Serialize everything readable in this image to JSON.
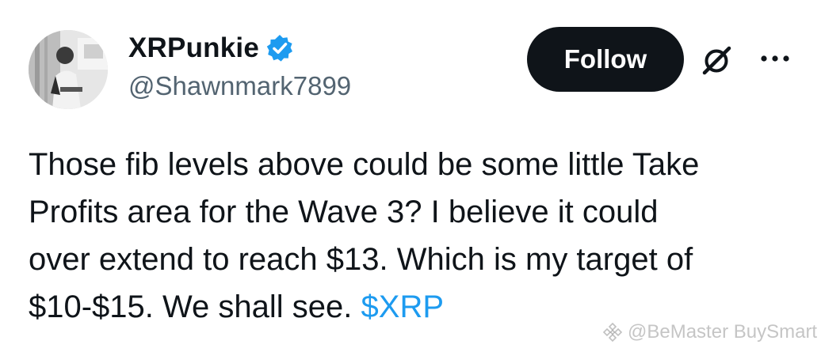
{
  "user": {
    "display_name": "XRPunkie",
    "handle": "@Shawnmark7899",
    "verified": true,
    "avatar_icon": "profile-photo"
  },
  "actions": {
    "follow_label": "Follow",
    "grok_icon": "grok-icon",
    "more_icon": "more-icon"
  },
  "tweet": {
    "lines": [
      "Those fib levels above could be some little Take",
      "Profits area for the Wave 3? I believe it could",
      "over extend to reach $13. Which is my target of",
      "$10-$15. We shall see. "
    ],
    "cashtag": "$XRP"
  },
  "watermark": {
    "text": "@BeMaster BuySmart"
  },
  "colors": {
    "text": "#0f1419",
    "secondary": "#536471",
    "accent": "#1d9bf0",
    "button_bg": "#0f1419",
    "button_text": "#ffffff"
  }
}
